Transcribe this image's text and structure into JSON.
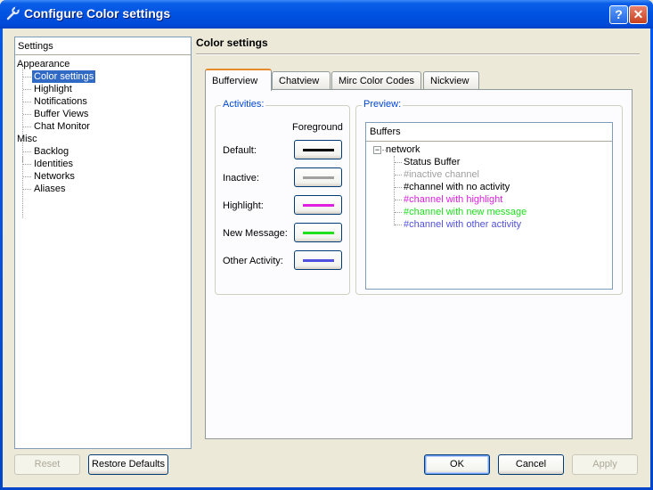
{
  "window": {
    "title": "Configure Color settings",
    "help_button": "?",
    "close_button": "✕"
  },
  "tree": {
    "header": "Settings",
    "items": [
      {
        "label": "Appearance",
        "level": 0
      },
      {
        "label": "Color settings",
        "level": 1,
        "selected": true
      },
      {
        "label": "Highlight",
        "level": 1
      },
      {
        "label": "Notifications",
        "level": 1
      },
      {
        "label": "Buffer Views",
        "level": 1
      },
      {
        "label": "Chat Monitor",
        "level": 1
      },
      {
        "label": "Misc",
        "level": 0
      },
      {
        "label": "Backlog",
        "level": 1
      },
      {
        "label": "Identities",
        "level": 1
      },
      {
        "label": "Networks",
        "level": 1
      },
      {
        "label": "Aliases",
        "level": 1
      }
    ]
  },
  "page": {
    "title": "Color settings"
  },
  "tabs": [
    {
      "label": "Bufferview",
      "active": true
    },
    {
      "label": "Chatview",
      "active": false
    },
    {
      "label": "Mirc Color Codes",
      "active": false
    },
    {
      "label": "Nickview",
      "active": false
    }
  ],
  "activities": {
    "group_label": "Activities:",
    "column_header": "Foreground",
    "rows": [
      {
        "label": "Default:",
        "color": "#000000"
      },
      {
        "label": "Inactive:",
        "color": "#a0a0a0"
      },
      {
        "label": "Highlight:",
        "color": "#e020e0"
      },
      {
        "label": "New Message:",
        "color": "#20e020"
      },
      {
        "label": "Other Activity:",
        "color": "#5050e0"
      }
    ]
  },
  "preview": {
    "group_label": "Preview:",
    "header": "Buffers",
    "network": "network",
    "expander": "−",
    "buffers": [
      {
        "label": "Status Buffer",
        "color": "#000000"
      },
      {
        "label": "#inactive channel",
        "color": "#a0a0a0"
      },
      {
        "label": "#channel with no activity",
        "color": "#000000"
      },
      {
        "label": "#channel with highlight",
        "color": "#e020e0"
      },
      {
        "label": "#channel with new message",
        "color": "#20e020"
      },
      {
        "label": "#channel with other activity",
        "color": "#5050e0"
      }
    ]
  },
  "buttons": {
    "reset": "Reset",
    "restore_defaults": "Restore Defaults",
    "ok": "OK",
    "cancel": "Cancel",
    "apply": "Apply"
  }
}
